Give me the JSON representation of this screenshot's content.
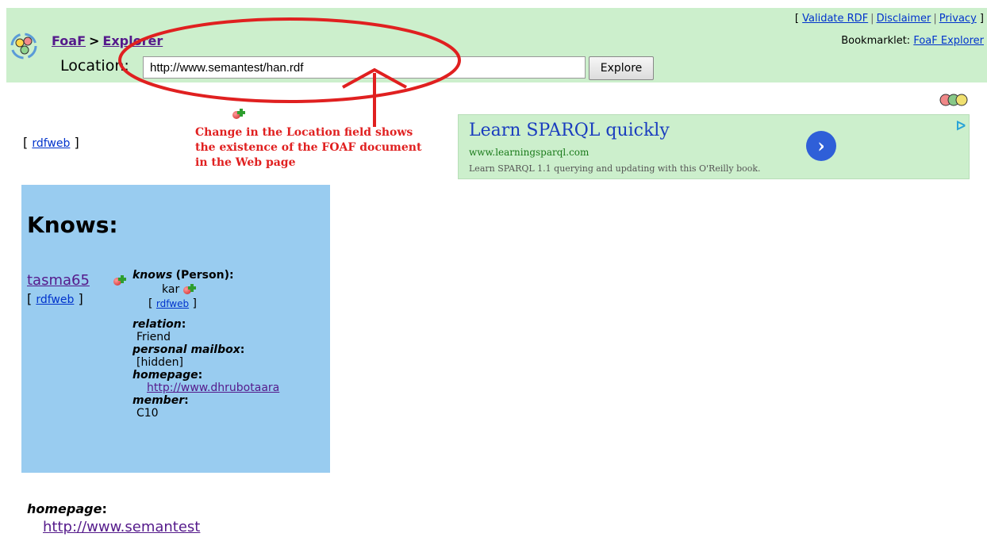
{
  "header": {
    "crumb_root": "FoaF",
    "crumb_sep": ">",
    "crumb_current": "Explorer",
    "location_label": "Location:",
    "location_value": "http://www.semantest/han.rdf",
    "explore_label": "Explore",
    "links_open": "[",
    "links_close": "]",
    "link_validate": "Validate RDF",
    "link_disclaimer": "Disclaimer",
    "link_privacy": "Privacy",
    "pipe": "|",
    "bookmarklet_label": "Bookmarklet:",
    "bookmarklet_link": "FoaF Explorer"
  },
  "annotation": {
    "line1": "Change in the Location field shows",
    "line2": "the existence of the FOAF document",
    "line3": "in the Web page",
    "color": "#e02020"
  },
  "top_rdfweb": {
    "open": "[",
    "label": "rdfweb",
    "close": "]"
  },
  "ad": {
    "title": "Learn SPARQL quickly",
    "url": "www.learningsparql.com",
    "description": "Learn SPARQL 1.1 querying and updating with this O'Reilly book.",
    "arrow_icon": "›",
    "choice_icon": "ᐅ"
  },
  "knows": {
    "heading": "Knows:",
    "person": "tasma65",
    "person_rdf_open": "[",
    "person_rdf_label": "rdfweb",
    "person_rdf_close": "]",
    "knows_name": "knows",
    "knows_type": "(Person):",
    "known_person": "kar",
    "known_rdf_open": "[",
    "known_rdf_label": "rdfweb",
    "known_rdf_close": "]",
    "relation_name": "relation",
    "relation_value": "Friend",
    "mailbox_name": "personal mailbox",
    "mailbox_value": "[hidden]",
    "homepage_name": "homepage",
    "homepage_value": "http://www.dhrubotaara",
    "member_name": "member",
    "member_value": "C10",
    "colon": ":"
  },
  "bottom": {
    "homepage_name": "homepage",
    "colon": ":",
    "homepage_value": "http://www.semantest"
  },
  "colors": {
    "header_bg": "#ccefcc",
    "knows_bg": "#99ccf0",
    "annotation": "#e02020"
  }
}
